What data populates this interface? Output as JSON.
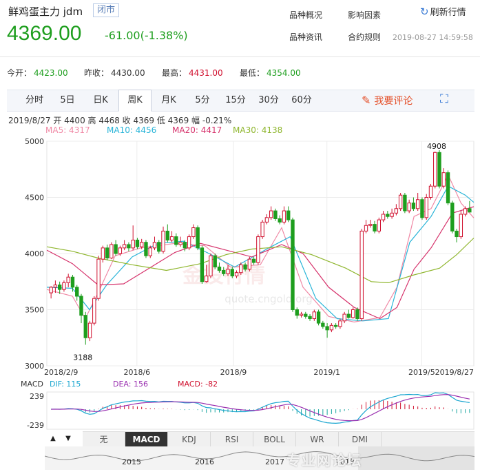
{
  "header": {
    "title": "鲜鸡蛋主力 jdm",
    "status_badge": "闭市",
    "price": "4369.00",
    "change": "-61.00(-1.38%)",
    "links": [
      "品种概况",
      "影响因素",
      "品种资讯",
      "合约规则"
    ],
    "refresh_label": "刷新行情",
    "datetime": "2019-08-27 14:59:58"
  },
  "stats": [
    {
      "label": "今开：",
      "value": "4423.00",
      "color": "#1e9e1e"
    },
    {
      "label": "昨收：",
      "value": "4430.00",
      "color": "#333333"
    },
    {
      "label": "最高：",
      "value": "4431.00",
      "color": "#d0102e"
    },
    {
      "label": "最低：",
      "value": "4354.00",
      "color": "#1e9e1e"
    }
  ],
  "tabs": [
    "分时",
    "5日",
    "日K",
    "周K",
    "月K",
    "5分",
    "15分",
    "30分",
    "60分"
  ],
  "active_tab": 3,
  "comment_label": "我要评论",
  "kline_info": "2019/8/27  开 4400  高 4468  收 4369  低 4369  幅 -0.21%",
  "ma_legend": [
    {
      "label": "MA5: 4317",
      "color": "#f08aa6"
    },
    {
      "label": "MA10: 4456",
      "color": "#28b4d8"
    },
    {
      "label": "MA20: 4417",
      "color": "#d6336c"
    },
    {
      "label": "MA30: 4138",
      "color": "#8fb62e"
    }
  ],
  "watermark": {
    "text": "金投行情",
    "sub": "quote.cngold.org"
  },
  "chart_data": {
    "type": "candlestick",
    "ylim": [
      3000,
      5000
    ],
    "yticks": [
      3000,
      3500,
      4000,
      4500,
      5000
    ],
    "xticks": [
      "2018/2/9",
      "2018/6",
      "2018/9",
      "2019/1",
      "2019/5",
      "2019/8/27"
    ],
    "xtick_positions": [
      0,
      0.211,
      0.437,
      0.656,
      0.878,
      1.0
    ],
    "annotations": [
      {
        "text": "4908",
        "value": 4908
      },
      {
        "text": "3188",
        "value": 3188
      }
    ],
    "candles": [
      [
        3650,
        3700,
        3600,
        3710
      ],
      [
        3700,
        3720,
        3650,
        3760
      ],
      [
        3720,
        3680,
        3640,
        3750
      ],
      [
        3680,
        3740,
        3660,
        3760
      ],
      [
        3740,
        3790,
        3700,
        3820
      ],
      [
        3790,
        3700,
        3660,
        3810
      ],
      [
        3700,
        3620,
        3580,
        3720
      ],
      [
        3620,
        3450,
        3380,
        3640
      ],
      [
        3450,
        3250,
        3188,
        3480
      ],
      [
        3250,
        3380,
        3220,
        3400
      ],
      [
        3380,
        3600,
        3360,
        3620
      ],
      [
        3600,
        3950,
        3580,
        3980
      ],
      [
        3950,
        4050,
        3920,
        4070
      ],
      [
        4050,
        3960,
        3940,
        4080
      ],
      [
        3960,
        4080,
        3950,
        4100
      ],
      [
        4080,
        4000,
        3980,
        4120
      ],
      [
        4000,
        4050,
        3980,
        4070
      ],
      [
        4050,
        4080,
        4030,
        4120
      ],
      [
        4080,
        4050,
        4020,
        4100
      ],
      [
        4050,
        4120,
        4030,
        4250
      ],
      [
        4120,
        4060,
        4040,
        4140
      ],
      [
        4060,
        4100,
        4040,
        4130
      ],
      [
        4100,
        3980,
        3960,
        4120
      ],
      [
        3980,
        4050,
        3960,
        4070
      ],
      [
        4050,
        4100,
        4030,
        4150
      ],
      [
        4100,
        4020,
        4000,
        4120
      ],
      [
        4020,
        4200,
        4000,
        4240
      ],
      [
        4200,
        4120,
        4100,
        4260
      ],
      [
        4120,
        4150,
        4100,
        4200
      ],
      [
        4150,
        4080,
        4060,
        4180
      ],
      [
        4080,
        4100,
        4060,
        4150
      ],
      [
        4100,
        4050,
        4020,
        4120
      ],
      [
        4050,
        4150,
        4030,
        4170
      ],
      [
        4150,
        4230,
        4130,
        4260
      ],
      [
        4230,
        4050,
        4030,
        4250
      ],
      [
        4050,
        3750,
        3730,
        4070
      ],
      [
        3750,
        3800,
        3740,
        3900
      ],
      [
        3800,
        3980,
        3780,
        4000
      ],
      [
        3980,
        3880,
        3860,
        4000
      ],
      [
        3880,
        3850,
        3830,
        3920
      ],
      [
        3850,
        3820,
        3800,
        3880
      ],
      [
        3820,
        3860,
        3800,
        3900
      ],
      [
        3860,
        3800,
        3780,
        3880
      ],
      [
        3800,
        3830,
        3780,
        3850
      ],
      [
        3830,
        3900,
        3810,
        3920
      ],
      [
        3900,
        3860,
        3840,
        3920
      ],
      [
        3860,
        3950,
        3840,
        3970
      ],
      [
        3950,
        3920,
        3900,
        3970
      ],
      [
        3920,
        4150,
        3900,
        4170
      ],
      [
        4150,
        4280,
        4130,
        4300
      ],
      [
        4280,
        4320,
        4260,
        4350
      ],
      [
        4320,
        4380,
        4300,
        4420
      ],
      [
        4380,
        4310,
        4290,
        4400
      ],
      [
        4310,
        4280,
        4260,
        4340
      ],
      [
        4280,
        4380,
        4260,
        4420
      ],
      [
        4380,
        4300,
        4280,
        4420
      ],
      [
        4300,
        3500,
        3480,
        4320
      ],
      [
        3500,
        3450,
        3420,
        3520
      ],
      [
        3450,
        3460,
        3430,
        3480
      ],
      [
        3460,
        3440,
        3420,
        3480
      ],
      [
        3440,
        3420,
        3400,
        3460
      ],
      [
        3420,
        3480,
        3400,
        3500
      ],
      [
        3480,
        3380,
        3360,
        3500
      ],
      [
        3380,
        3350,
        3330,
        3400
      ],
      [
        3350,
        3320,
        3250,
        3380
      ],
      [
        3320,
        3360,
        3300,
        3380
      ],
      [
        3360,
        3350,
        3330,
        3380
      ],
      [
        3350,
        3400,
        3330,
        3420
      ],
      [
        3400,
        3460,
        3380,
        3480
      ],
      [
        3460,
        3430,
        3420,
        3500
      ],
      [
        3430,
        3500,
        3420,
        3520
      ],
      [
        3500,
        3420,
        3400,
        3520
      ],
      [
        3420,
        4200,
        3400,
        4220
      ],
      [
        4200,
        4250,
        4180,
        4300
      ],
      [
        4250,
        4260,
        4230,
        4300
      ],
      [
        4260,
        4200,
        4180,
        4290
      ],
      [
        4200,
        4300,
        4180,
        4320
      ],
      [
        4300,
        4350,
        4280,
        4380
      ],
      [
        4350,
        4330,
        4310,
        4380
      ],
      [
        4330,
        4360,
        4310,
        4400
      ],
      [
        4360,
        4400,
        4340,
        4440
      ],
      [
        4400,
        4520,
        4380,
        4540
      ],
      [
        4520,
        4380,
        4360,
        4540
      ],
      [
        4380,
        4450,
        4360,
        4480
      ],
      [
        4450,
        4400,
        4380,
        4500
      ],
      [
        4400,
        4480,
        4380,
        4540
      ],
      [
        4480,
        4320,
        4300,
        4500
      ],
      [
        4320,
        4500,
        4300,
        4530
      ],
      [
        4500,
        4600,
        4480,
        4620
      ],
      [
        4600,
        4900,
        4580,
        4908
      ],
      [
        4900,
        4600,
        4580,
        4920
      ],
      [
        4600,
        4720,
        4580,
        4760
      ],
      [
        4720,
        4450,
        4430,
        4740
      ],
      [
        4450,
        4200,
        4180,
        4470
      ],
      [
        4200,
        4150,
        4100,
        4220
      ],
      [
        4150,
        4350,
        4130,
        4380
      ],
      [
        4350,
        4400,
        4330,
        4420
      ],
      [
        4400,
        4369,
        4369,
        4468
      ]
    ],
    "ma_lines": [
      {
        "name": "MA5",
        "color": "#f08aa6",
        "values": [
          [
            0,
            3680
          ],
          [
            0.06,
            3620
          ],
          [
            0.09,
            3420
          ],
          [
            0.12,
            3650
          ],
          [
            0.16,
            3980
          ],
          [
            0.22,
            4050
          ],
          [
            0.3,
            4090
          ],
          [
            0.37,
            4070
          ],
          [
            0.43,
            3880
          ],
          [
            0.5,
            3900
          ],
          [
            0.55,
            4230
          ],
          [
            0.6,
            3700
          ],
          [
            0.66,
            3440
          ],
          [
            0.72,
            3390
          ],
          [
            0.78,
            3430
          ],
          [
            0.82,
            3700
          ],
          [
            0.86,
            4330
          ],
          [
            0.9,
            4400
          ],
          [
            0.94,
            4700
          ],
          [
            0.97,
            4450
          ],
          [
            1.0,
            4317
          ]
        ]
      },
      {
        "name": "MA10",
        "color": "#28b4d8",
        "values": [
          [
            0,
            3700
          ],
          [
            0.06,
            3690
          ],
          [
            0.1,
            3500
          ],
          [
            0.14,
            3720
          ],
          [
            0.2,
            3970
          ],
          [
            0.26,
            4090
          ],
          [
            0.32,
            4110
          ],
          [
            0.38,
            4000
          ],
          [
            0.44,
            3880
          ],
          [
            0.52,
            4050
          ],
          [
            0.57,
            4150
          ],
          [
            0.63,
            3600
          ],
          [
            0.68,
            3420
          ],
          [
            0.74,
            3400
          ],
          [
            0.8,
            3420
          ],
          [
            0.85,
            4100
          ],
          [
            0.9,
            4330
          ],
          [
            0.94,
            4600
          ],
          [
            0.98,
            4520
          ],
          [
            1.0,
            4456
          ]
        ]
      },
      {
        "name": "MA20",
        "color": "#d6336c",
        "values": [
          [
            0,
            4030
          ],
          [
            0.06,
            3910
          ],
          [
            0.12,
            3720
          ],
          [
            0.18,
            3730
          ],
          [
            0.24,
            3870
          ],
          [
            0.3,
            4010
          ],
          [
            0.36,
            4090
          ],
          [
            0.42,
            4030
          ],
          [
            0.48,
            3970
          ],
          [
            0.55,
            4080
          ],
          [
            0.6,
            4000
          ],
          [
            0.66,
            3700
          ],
          [
            0.72,
            3520
          ],
          [
            0.78,
            3420
          ],
          [
            0.82,
            3520
          ],
          [
            0.86,
            3860
          ],
          [
            0.9,
            4050
          ],
          [
            0.95,
            4360
          ],
          [
            1.0,
            4417
          ]
        ]
      },
      {
        "name": "MA30",
        "color": "#8fb62e",
        "values": [
          [
            0,
            4060
          ],
          [
            0.06,
            4020
          ],
          [
            0.12,
            3960
          ],
          [
            0.2,
            3900
          ],
          [
            0.28,
            3850
          ],
          [
            0.36,
            3910
          ],
          [
            0.42,
            3990
          ],
          [
            0.48,
            4040
          ],
          [
            0.55,
            4060
          ],
          [
            0.62,
            3990
          ],
          [
            0.7,
            3870
          ],
          [
            0.76,
            3750
          ],
          [
            0.8,
            3740
          ],
          [
            0.86,
            3810
          ],
          [
            0.92,
            3870
          ],
          [
            0.96,
            3990
          ],
          [
            1.0,
            4138
          ]
        ]
      }
    ]
  },
  "macd": {
    "label": "MACD",
    "dif": "DIF: 115",
    "dea": "DEA: 156",
    "macd": "MACD: -82",
    "dif_color": "#1aa6d0",
    "dea_color": "#9a2fb0",
    "macd_color": "#d0102e",
    "yticks": [
      "239",
      "-239"
    ]
  },
  "indicator_buttons": [
    "无",
    "MACD",
    "KDJ",
    "RSI",
    "BOLL",
    "WR",
    "DMI"
  ],
  "active_indicator": 1,
  "nav_arrows": {
    "up": "▲",
    "down": "▼"
  },
  "minimap_years": [
    "2015",
    "2016",
    "2017",
    "2018"
  ],
  "bottom_watermark": "专业网论坛"
}
